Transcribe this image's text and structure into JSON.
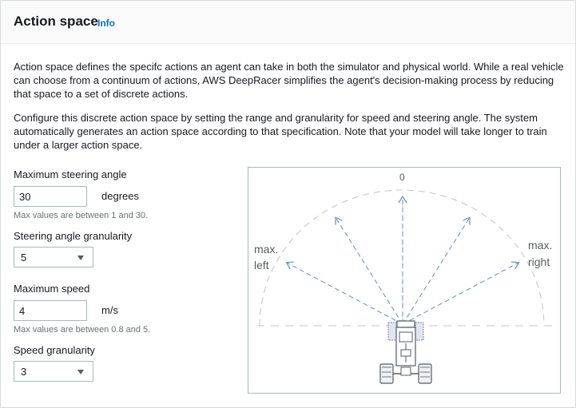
{
  "header": {
    "title": "Action space",
    "info_link": "Info"
  },
  "description": {
    "paragraph1": "Action space defines the specifc actions an agent can take in both the simulator and physical world. While a real vehicle can choose from a continuum of actions, AWS DeepRacer simplifies the agent's decision-making process by reducing that space to a set of discrete actions.",
    "paragraph2": "Configure this discrete action space by setting the range and granularity for speed and steering angle. The system automatically generates an action space according to that specification. Note that your model will take longer to train under a larger action space."
  },
  "steering_angle": {
    "label": "Maximum steering angle",
    "value": "30",
    "unit": "degrees",
    "hint": "Max values are between 1 and 30."
  },
  "steering_granularity": {
    "label": "Steering angle granularity",
    "selected": "5"
  },
  "max_speed": {
    "label": "Maximum speed",
    "value": "4",
    "unit": "m/s",
    "hint": "Max values are between 0.8 and 5."
  },
  "speed_granularity": {
    "label": "Speed granularity",
    "selected": "3"
  },
  "diagram": {
    "center_label": "0",
    "left_label_line1": "max.",
    "left_label_line2": "left",
    "right_label_line1": "max.",
    "right_label_line2": "right",
    "arrow_color": "#5b8fd1"
  }
}
